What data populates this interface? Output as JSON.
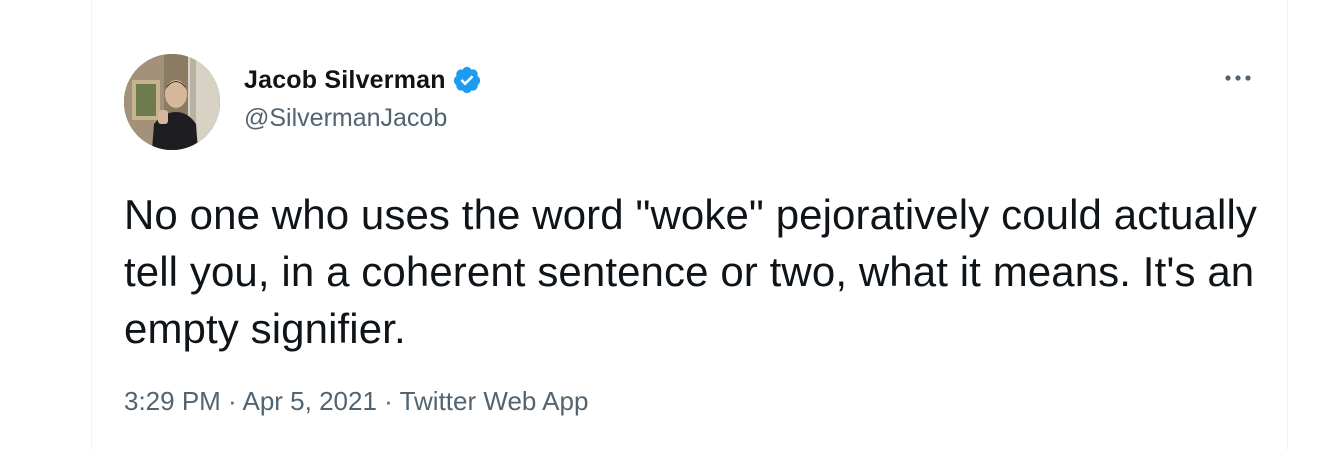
{
  "tweet": {
    "author": {
      "display_name": "Jacob Silverman",
      "handle": "@SilvermanJacob",
      "verified": true,
      "avatar_icon": "profile-photo"
    },
    "text": "No one who uses the word \"woke\" pejoratively could actually tell you, in a coherent sentence or two, what it means. It's an empty signifier.",
    "meta": {
      "time": "3:29 PM",
      "separator": " · ",
      "date": "Apr 5, 2021",
      "source": "Twitter Web App"
    },
    "more_icon": "ellipsis-horizontal-icon"
  },
  "colors": {
    "text_primary": "#0f1419",
    "text_secondary": "#536471",
    "verified_blue": "#1d9bf0",
    "border": "#eff3f4"
  }
}
